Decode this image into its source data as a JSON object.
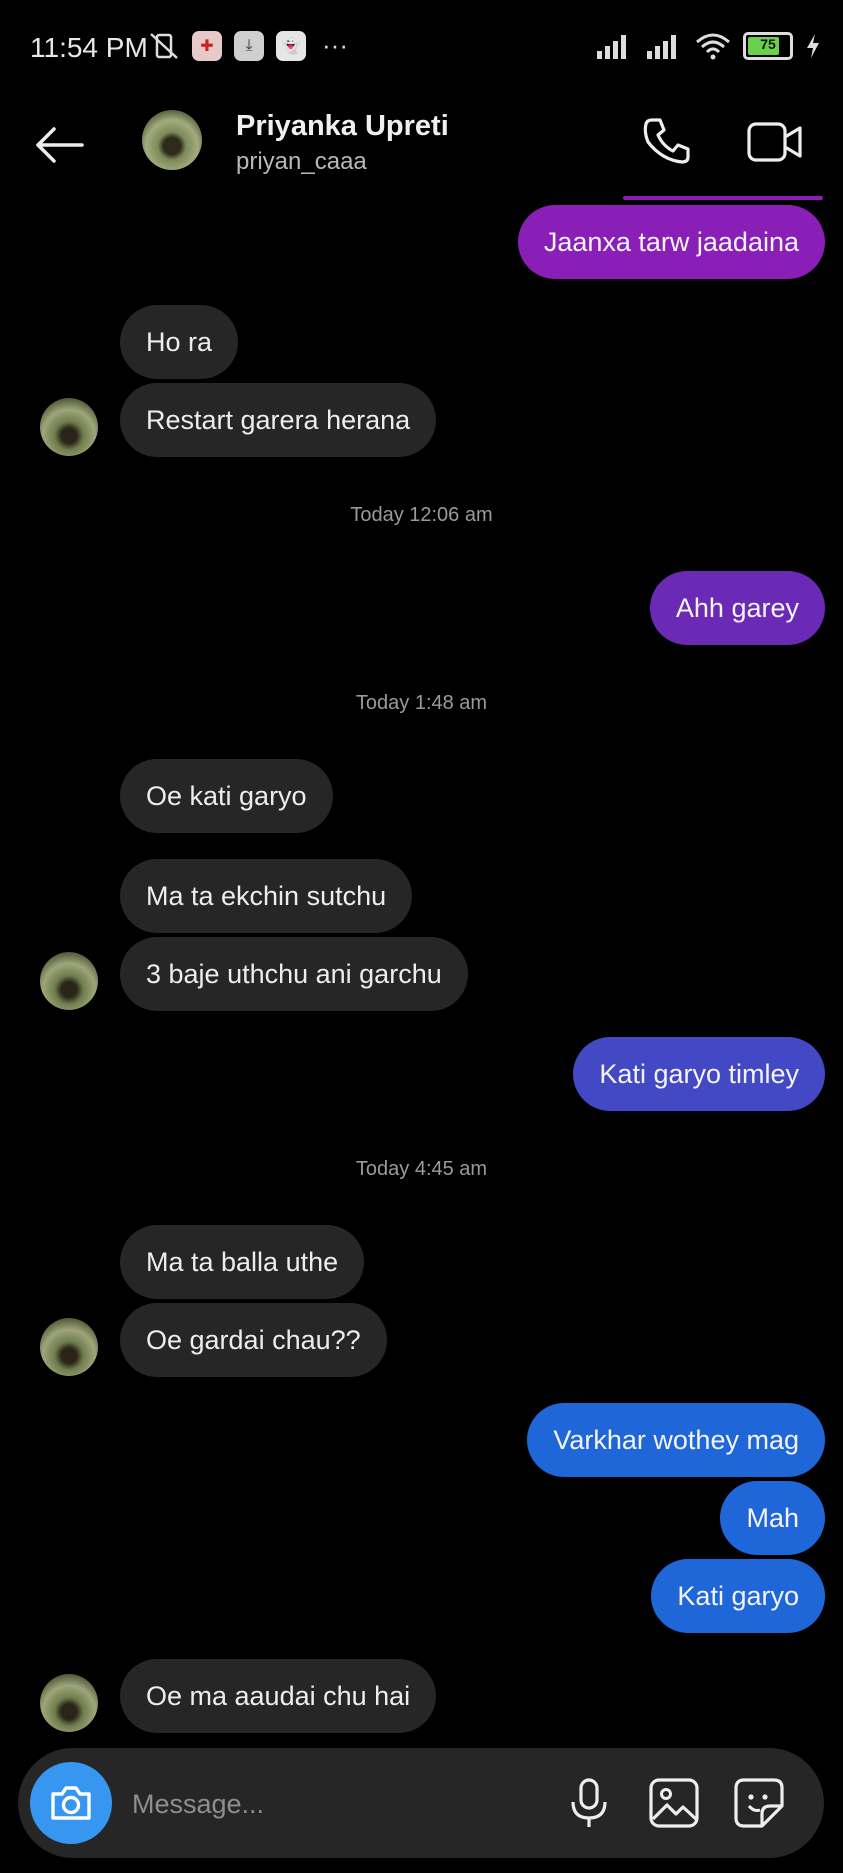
{
  "status_bar": {
    "time": "11:54 PM",
    "dots": "···",
    "battery": "75"
  },
  "header": {
    "name": "Priyanka Upreti",
    "username": "priyan_caaa"
  },
  "messages": [
    {
      "dir": "out",
      "text": "Jaanxa tarw jaadaina",
      "color": "#8a1fb8"
    },
    {
      "dir": "in",
      "text": "Ho ra"
    },
    {
      "dir": "in",
      "text": "Restart garera herana"
    },
    {
      "type": "time",
      "text": "Today 12:06 am"
    },
    {
      "dir": "out",
      "text": "Ahh garey",
      "color": "#6a2ab6"
    },
    {
      "type": "time",
      "text": "Today 1:48 am"
    },
    {
      "dir": "in",
      "text": "Oe kati garyo"
    },
    {
      "dir": "in",
      "text": "Ma ta ekchin sutchu"
    },
    {
      "dir": "in",
      "text": "3 baje uthchu ani garchu"
    },
    {
      "dir": "out",
      "text": "Kati garyo timley",
      "color": "#4348c4"
    },
    {
      "type": "time",
      "text": "Today 4:45 am"
    },
    {
      "dir": "in",
      "text": "Ma ta balla uthe"
    },
    {
      "dir": "in",
      "text": "Oe gardai chau??"
    },
    {
      "dir": "out",
      "text": "Varkhar wothey mag",
      "color": "#1f66d8"
    },
    {
      "dir": "out",
      "text": "Mah",
      "color": "#1f66d8"
    },
    {
      "dir": "out",
      "text": "Kati garyo",
      "color": "#1f66d8"
    },
    {
      "dir": "in",
      "text": "Oe ma aaudai chu hai"
    }
  ],
  "composer": {
    "placeholder": "Message..."
  },
  "icons": {
    "back": "arrow-left-icon",
    "call": "phone-icon",
    "video": "video-camera-icon",
    "camera": "camera-icon",
    "mic": "microphone-icon",
    "gallery": "image-icon",
    "sticker": "sticker-icon"
  },
  "colors": {
    "camera_button": "#3797f0",
    "incoming_bubble": "#262626"
  }
}
